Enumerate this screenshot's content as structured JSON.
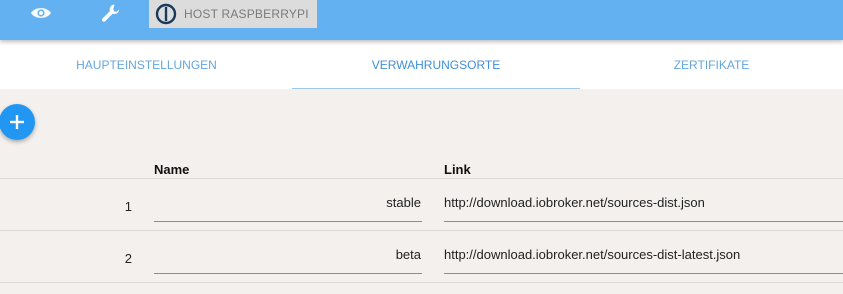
{
  "topbar": {
    "icons": [
      "eye-icon",
      "wrench-icon"
    ],
    "host_label": "HOST RASPBERRYPI",
    "colors": {
      "bar": "#64b1f2",
      "host_box": "#dcdcdc"
    }
  },
  "tabs": [
    {
      "label": "HAUPTEINSTELLUNGEN",
      "active": false
    },
    {
      "label": "VERWAHRUNGSORTE",
      "active": true
    },
    {
      "label": "ZERTIFIKATE",
      "active": false
    }
  ],
  "add_button": {
    "icon": "plus-icon",
    "color": "#2196f3"
  },
  "table": {
    "headers": {
      "name": "Name",
      "link": "Link"
    },
    "rows": [
      {
        "index": "1",
        "name": "stable",
        "link": "http://download.iobroker.net/sources-dist.json"
      },
      {
        "index": "2",
        "name": "beta",
        "link": "http://download.iobroker.net/sources-dist-latest.json"
      }
    ]
  }
}
